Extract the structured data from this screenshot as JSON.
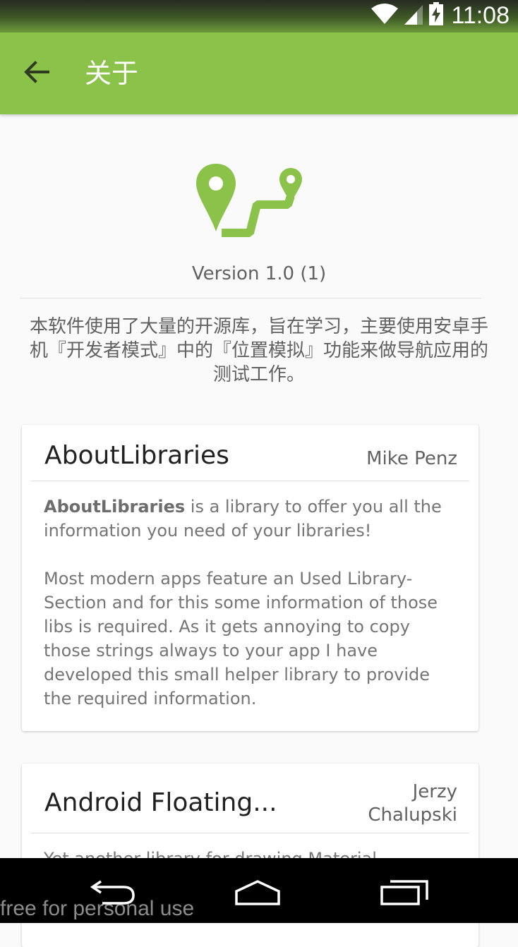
{
  "status_bar": {
    "time": "11:08",
    "icons": [
      "wifi-icon",
      "signal-icon",
      "battery-charging-icon"
    ]
  },
  "app_bar": {
    "title": "关于",
    "back_icon": "arrow-back-icon",
    "background_color": "#8bc34a"
  },
  "header": {
    "logo_icon": "route-pins-logo",
    "version": "Version 1.0 (1)",
    "description": "本软件使用了大量的开源库，旨在学习，主要使用安卓手机『开发者模式』中的『位置模拟』功能来做导航应用的测试工作。"
  },
  "libraries": [
    {
      "name": "AboutLibraries",
      "author": "Mike Penz",
      "description_bold": "AboutLibraries",
      "description_rest": " is a library to offer you all the information you need of your libraries!",
      "description_2": "Most modern apps feature an Used Library-Section and for this some information of those libs is required. As it gets annoying to copy those strings always to your app I have developed this small helper library to provide the required information."
    },
    {
      "name": "Android Floating...",
      "author": "Jerzy Chalupski",
      "description": "Yet another library for drawing Material"
    }
  ],
  "nav_bar": {
    "icons": [
      "nav-back-icon",
      "nav-home-icon",
      "nav-recents-icon"
    ]
  },
  "watermark": "free for personal use"
}
